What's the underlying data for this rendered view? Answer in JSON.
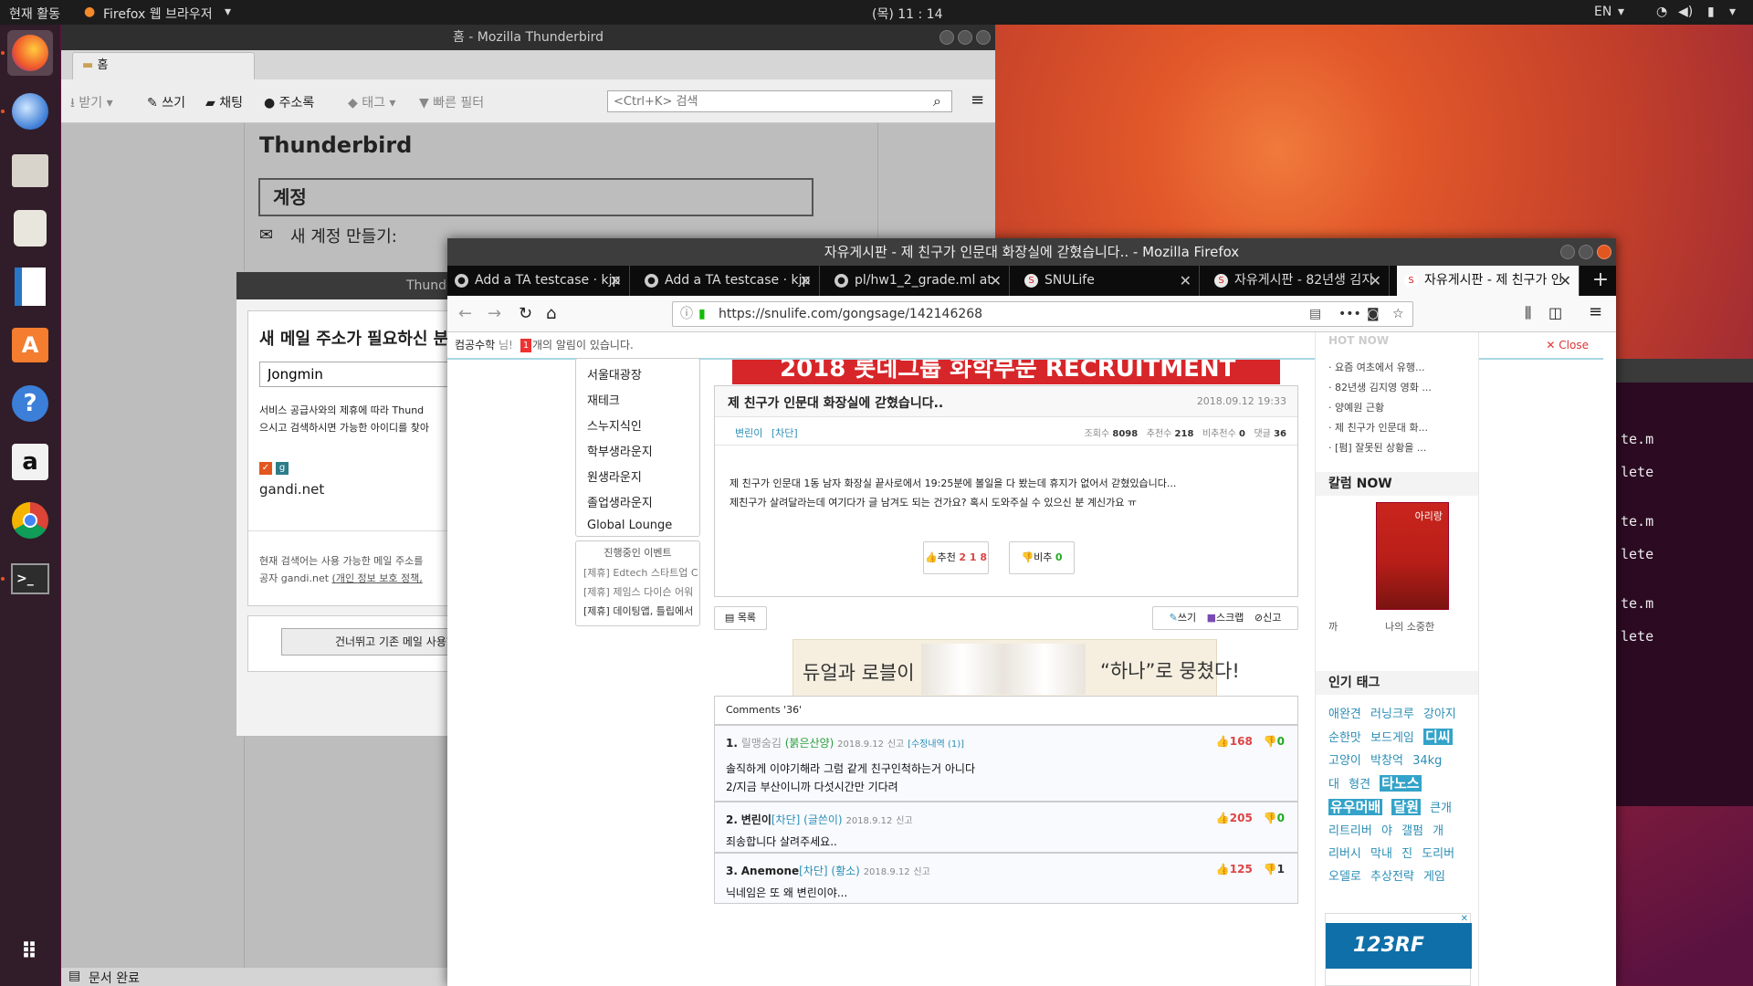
{
  "topbar": {
    "activities": "현재 활동",
    "app_menu": "Firefox 웹 브라우저",
    "clock": "(목) 11 : 14",
    "lang": "EN"
  },
  "terminal": {
    "lines": [
      "te.m",
      "lete",
      "te.m",
      "lete",
      "te.m",
      "lete"
    ]
  },
  "thunderbird": {
    "title": "홈 - Mozilla Thunderbird",
    "tab": "홈",
    "toolbar": {
      "get": "받기",
      "write": "쓰기",
      "chat": "채팅",
      "address": "주소록",
      "tag": "태그",
      "filter": "빠른 필터",
      "search_placeholder": "<Ctrl+K> 검색"
    },
    "heading": "Thunderbird",
    "section": "계정",
    "new_account": "새 계정 만들기:",
    "status": "문서 완료"
  },
  "account_dialog": {
    "header": "Thunde",
    "title": "새 메일 주소가 필요하신 분",
    "name_value": "Jongmin",
    "desc1": "서비스 공급사와의 제휴에 따라 Thund",
    "desc2": "으시고 검색하시면 가능한 아이디를 찾아",
    "provider": "gandi.net",
    "footer1": "현재 검색어는 사용 가능한 메일 주소를",
    "footer2": "공자 gandi.net",
    "footer_link": "(개인 정보 보호 정책,",
    "skip": "건너뛰고 기존 메일 사용하기"
  },
  "firefox": {
    "title": "자유게시판 - 제 친구가 인문대 화장실에 갇혔습니다.. - Mozilla Firefox",
    "tabs": [
      "Add a TA testcase · kjp",
      "Add a TA testcase · kjp",
      "pl/hw1_2_grade.ml at",
      "SNULife",
      "자유게시판 - 82년생 김지",
      "자유게시판 - 제 친구가 인"
    ],
    "url": "https://snulife.com/gongsage/142146268"
  },
  "page": {
    "notif_user": "컴공수학",
    "notif_suffix": " 님!",
    "notif_count": "1",
    "notif_text": "개의 알림이 있습니다.",
    "close": "Close",
    "banner": "2018 롯데그룹 화학부문 RECRUITMENT",
    "leftnav": [
      "서울대광장",
      "재테크",
      "스누지식인",
      "학부생라운지",
      "원생라운지",
      "졸업생라운지",
      "Global Lounge"
    ],
    "events_title": "진행중인 이벤트",
    "events": [
      "[제휴] Edtech 스타트업 C",
      "[제휴] 제임스 다이슨 어워",
      "[제휴] 데이팅앱, 틀립에서"
    ],
    "post": {
      "title": "제 친구가 인문대 화장실에 갇혔습니다..",
      "date": "2018.09.12 19:33",
      "author": "변린이",
      "block": "[차단]",
      "views_label": "조회수",
      "views": "8098",
      "rec_label": "추천수",
      "rec": "218",
      "nrec_label": "비추천수",
      "nrec": "0",
      "cmt_label": "댓글",
      "cmt": "36",
      "body1": "제 친구가 인문대 1동 남자 화장실 끝사로에서 19:25분에 볼일을 다 봤는데 휴지가 없어서 갇혔있습니다...",
      "body2": "제친구가 살려달라는데 여기다가 글 남겨도 되는 건가요? 혹시 도와주실 수 있으신 분 계신가요 ㅠ",
      "up_label": "추천",
      "up": "2 1 8",
      "down_label": "비추",
      "down": "0"
    },
    "list_btn": "목록",
    "write_btn": "쓰기",
    "scrap_btn": "스크랩",
    "report_btn": "신고",
    "ad_text1": "듀얼과 로블이",
    "ad_text2": "“하나”로 뭉쳤다!",
    "comments_title": "Comments '36'",
    "comments": [
      {
        "num": "1.",
        "name": "릴맹숨김",
        "tag": "(붉은산양)",
        "date": "2018.9.12",
        "report": "신고",
        "extra": "[수정내역 (1)]",
        "up": "168",
        "down": "0",
        "lines": [
          "솔직하게 이야기해라 그럼 같게 친구인척하는거 아니다",
          "2/지금 부산이니까 다섯시간만 기다려"
        ]
      },
      {
        "num": "2.",
        "name": "변린이",
        "tag": "[차단] (글쓴이)",
        "date": "2018.9.12",
        "report": "신고",
        "extra": "",
        "up": "205",
        "down": "0",
        "lines": [
          "죄송합니다 살려주세요.."
        ]
      },
      {
        "num": "3.",
        "name": "Anemone",
        "tag": "[차단] (황소)",
        "date": "2018.9.12",
        "report": "신고",
        "extra": "",
        "up": "125",
        "down": "1",
        "lines": [
          "닉네임은 또 왜 변린이야..."
        ]
      }
    ],
    "hot_title": "HOT NOW",
    "hot": [
      "요즘 여초에서 유행...",
      "82년생 김지영 영화 ...",
      "양예원 근황",
      "제 친구가 인문대 화...",
      "[펌] 잘못된 상황을 ..."
    ],
    "column_title": "칼럼 NOW",
    "column_book": "아리랑",
    "column_prefix": "까",
    "column_caption": "나의 소중한",
    "tags_title": "인기 태그",
    "tags": [
      {
        "t": "애완견",
        "b": false
      },
      {
        "t": "러닝크루",
        "b": false
      },
      {
        "t": "강아지",
        "b": false
      },
      {
        "t": "순한맛",
        "b": false
      },
      {
        "t": "보드게임",
        "b": false
      },
      {
        "t": "디씨",
        "b": true
      },
      {
        "t": "고양이",
        "b": false
      },
      {
        "t": "박창억",
        "b": false
      },
      {
        "t": "34kg",
        "b": false
      },
      {
        "t": "대",
        "b": false
      },
      {
        "t": "형견",
        "b": false
      },
      {
        "t": "타노스",
        "b": true
      },
      {
        "t": "유우머배",
        "b": true
      },
      {
        "t": "달원",
        "b": true
      },
      {
        "t": "큰개",
        "b": false
      },
      {
        "t": "리트리버",
        "b": false
      },
      {
        "t": "야",
        "b": false
      },
      {
        "t": "갤펌",
        "b": false
      },
      {
        "t": "개",
        "b": false
      },
      {
        "t": "리버시",
        "b": false
      },
      {
        "t": "막내",
        "b": false
      },
      {
        "t": "진",
        "b": false
      },
      {
        "t": "도리버",
        "b": false
      },
      {
        "t": "오델로",
        "b": false
      },
      {
        "t": "추상전략",
        "b": false
      },
      {
        "t": "게임",
        "b": false
      }
    ],
    "ad_brand": "123RF"
  },
  "colors": {
    "accent": "#e95420",
    "link": "#2b8eb5",
    "banner": "#d7262a"
  }
}
